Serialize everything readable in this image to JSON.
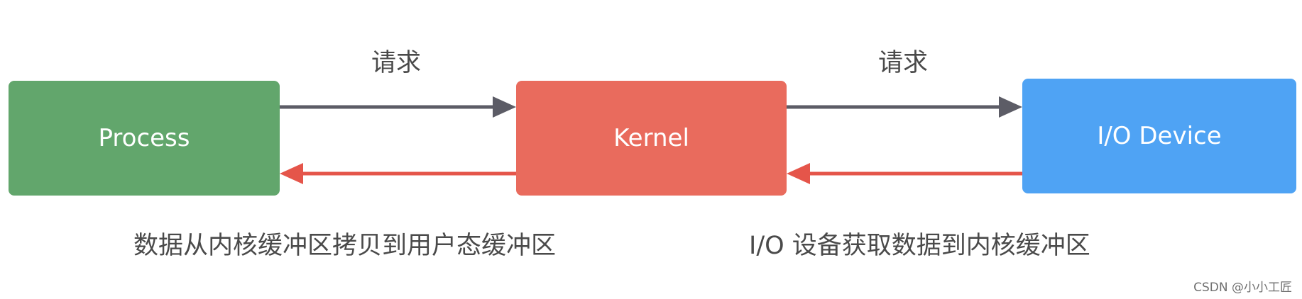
{
  "boxes": {
    "process": {
      "label": "Process",
      "color": "#62a66c"
    },
    "kernel": {
      "label": "Kernel",
      "color": "#e96b5d"
    },
    "device": {
      "label": "I/O Device",
      "color": "#4fa3f4"
    }
  },
  "arrows": {
    "request_label_1": "请求",
    "request_label_2": "请求",
    "request_color": "#5c5c66",
    "response_color": "#e5554a"
  },
  "captions": {
    "kernel_to_user": "数据从内核缓冲区拷贝到用户态缓冲区",
    "device_to_kernel": "I/O 设备获取数据到内核缓冲区"
  },
  "watermark": "CSDN @小小工匠"
}
